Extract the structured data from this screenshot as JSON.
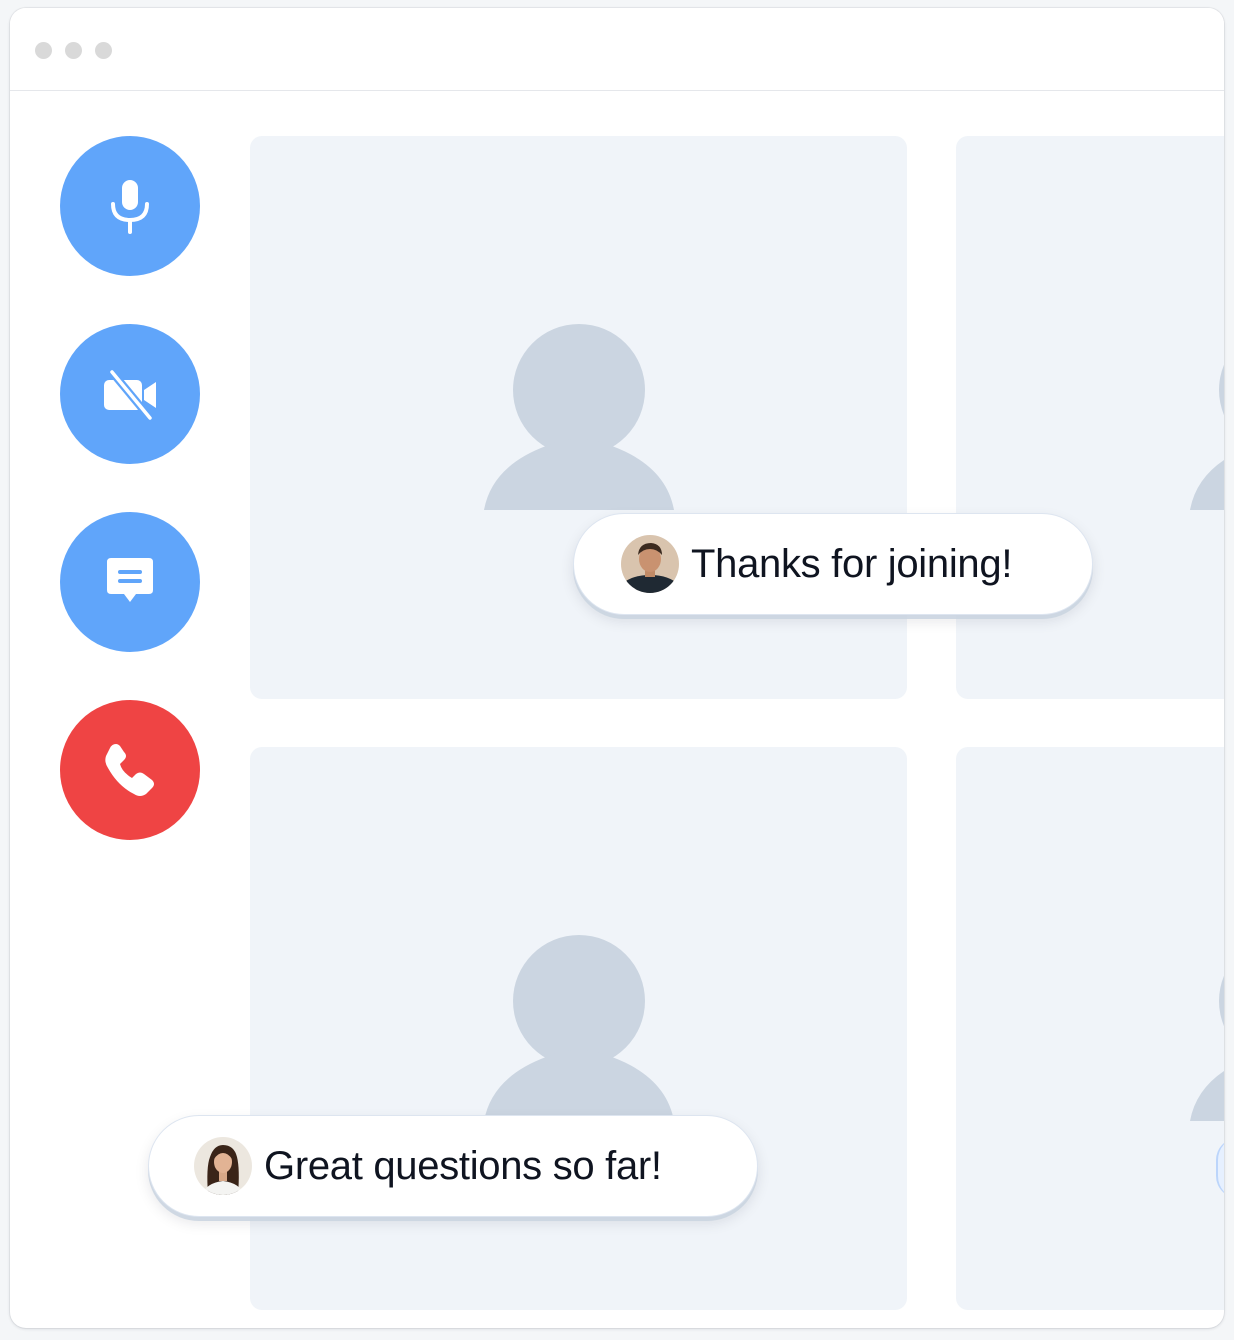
{
  "window": {
    "titlebar_dots": [
      "dot-1",
      "dot-2",
      "dot-3"
    ]
  },
  "controls": [
    {
      "name": "microphone",
      "icon": "microphone-icon",
      "color": "#60a5fa"
    },
    {
      "name": "camera-off",
      "icon": "video-off-icon",
      "color": "#60a5fa"
    },
    {
      "name": "chat",
      "icon": "chat-icon",
      "color": "#60a5fa"
    },
    {
      "name": "hang-up",
      "icon": "phone-icon",
      "color": "#ef4444"
    }
  ],
  "colors": {
    "accent": "#60a5fa",
    "danger": "#ef4444",
    "tile_background": "#f0f4f9",
    "placeholder": "#cbd5e1"
  },
  "messages": [
    {
      "text": "Thanks for joining!",
      "avatar": "man-avatar"
    },
    {
      "text": "Great questions so far!",
      "avatar": "woman-avatar"
    }
  ]
}
